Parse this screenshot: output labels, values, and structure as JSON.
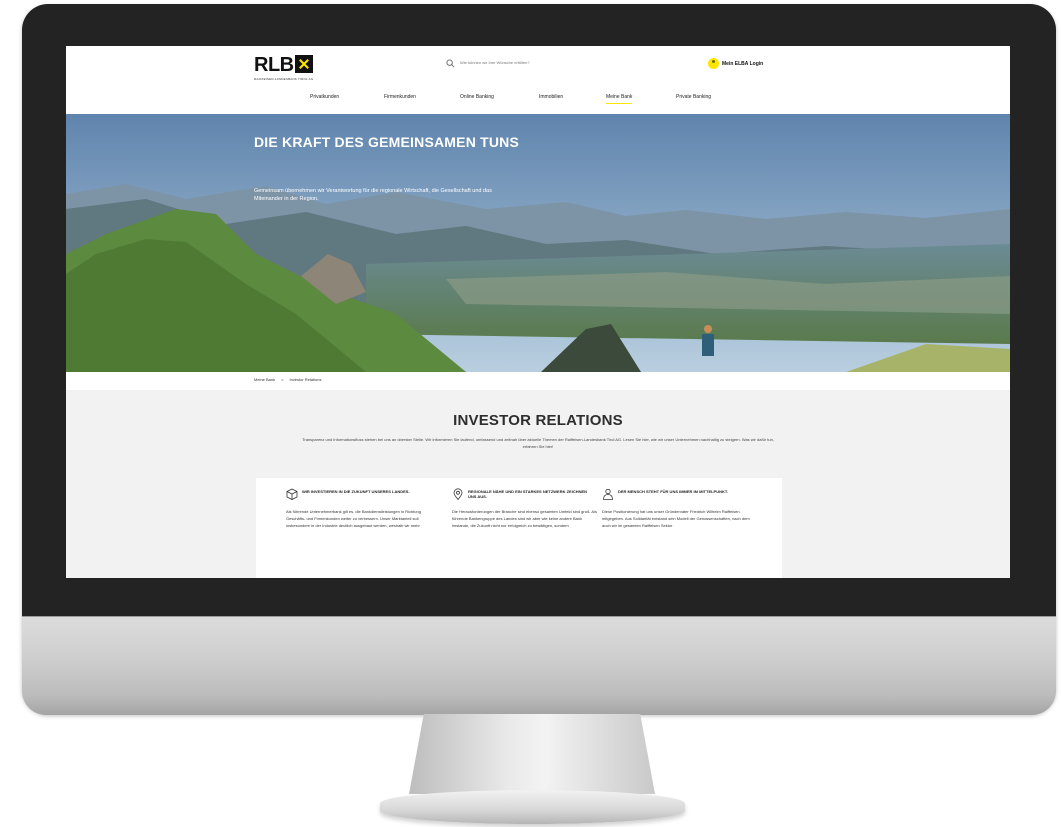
{
  "brand": {
    "logo_text": "RLB",
    "logo_subtitle": "RAIFFEISEN-LANDESBANK TIROL AG",
    "accent_color": "#ffe600"
  },
  "header": {
    "search_placeholder": "Wie können wir Ihre Wünsche erfüllen?",
    "search_icon": "search-icon",
    "login_label": "Mein ELBA Login",
    "login_icon": "user-icon"
  },
  "nav": {
    "items": [
      {
        "label": "Privatkunden"
      },
      {
        "label": "Firmenkunden"
      },
      {
        "label": "Online Banking"
      },
      {
        "label": "Immobilien"
      },
      {
        "label": "Meine Bank",
        "active": true
      },
      {
        "label": "Private Banking"
      }
    ]
  },
  "hero": {
    "title": "DIE KRAFT DES GEMEINSAMEN TUNS",
    "text": "Gemeinsam übernehmen wir Verantwortung für die regionale Wirtschaft, die Gesellschaft und das Miteinander in der Region."
  },
  "breadcrumb": {
    "items": [
      "Meine Bank",
      ">",
      "Investor Relations"
    ]
  },
  "investor_relations": {
    "title": "INVESTOR RELATIONS",
    "intro": "Transparenz und Informationsfluss stehen bei uns an oberster Stelle. Wir informieren Sie laufend, umfassend und zeitnah über aktuelle Themen der Raiffeisen-Landesbank Tirol AG. Lesen Sie hier, wie wir unser Unternehmen nachhaltig zu steigern. Was wir dafür tun, erfahren Sie hier!",
    "cards": [
      {
        "icon": "cube-icon",
        "title": "WIR INVESTIEREN IN DIE ZUKUNFT UNSERES LANDES.",
        "text": "Als führende Unternehmerbank gilt es, die Bankdienstleistungen in Richtung Geschäfts- und Firmenkunden weiter zu verbessern. Unser Marktanteil soll insbesondere in der Industrie deutlich ausgebaut werden, weshalb wir mehr"
      },
      {
        "icon": "location-pin-icon",
        "title": "REGIONALE NÄHE UND EIN STARKES NETZWERK ZEICHNEN UNS AUS.",
        "text": "Die Herausforderungen der Branche sind ebenso gesamten Umfeld sind groß. Als führende Bankengruppe des Landes sind wir aber wie keine andere Bank imstande, die Zukunft nicht nur erfolgreich zu bewältigen, sondern"
      },
      {
        "icon": "people-icon",
        "title": "DER MENSCH STEHT FÜR UNS IMMER IM MITTELPUNKT.",
        "text": "Diese Positionierung hat uns unser Gründervater Friedrich Wilhelm Raiffeisen mitgegeben. Aus Solidarität entstand sein Modell der Genossenschaften, nach dem auch wir im gesamten Raiffeisen Sektor"
      }
    ]
  }
}
